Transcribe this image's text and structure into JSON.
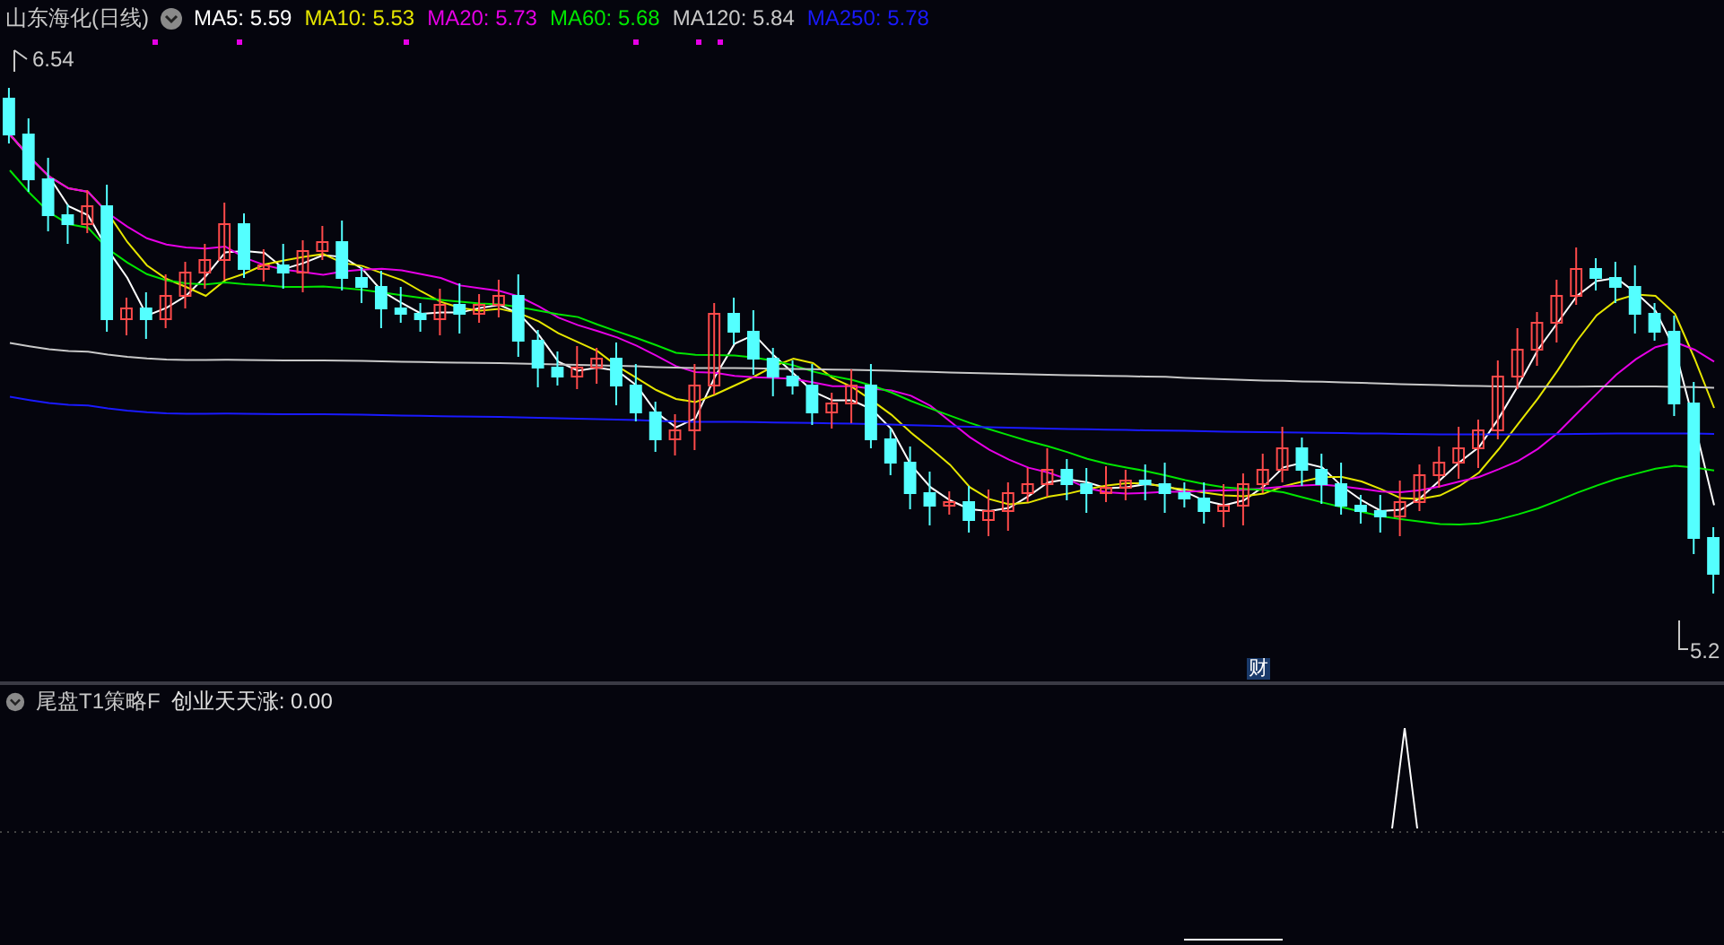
{
  "main_panel": {
    "title": "山东海化(日线)",
    "moving_averages": [
      {
        "label": "MA5:",
        "value": "5.59",
        "color": "#ffffff"
      },
      {
        "label": "MA10:",
        "value": "5.53",
        "color": "#e6e600"
      },
      {
        "label": "MA20:",
        "value": "5.73",
        "color": "#e600e6"
      },
      {
        "label": "MA60:",
        "value": "5.68",
        "color": "#00e600"
      },
      {
        "label": "MA120:",
        "value": "5.84",
        "color": "#c8c8c8"
      },
      {
        "label": "MA250:",
        "value": "5.78",
        "color": "#1a1aff"
      }
    ],
    "high_marker": "6.54",
    "low_marker": "5.2",
    "event_badge": "财"
  },
  "indicator_panel": {
    "name": "尾盘T1策略F",
    "readings": [
      {
        "label": "创业天天涨:",
        "value": "0.00"
      }
    ]
  }
}
